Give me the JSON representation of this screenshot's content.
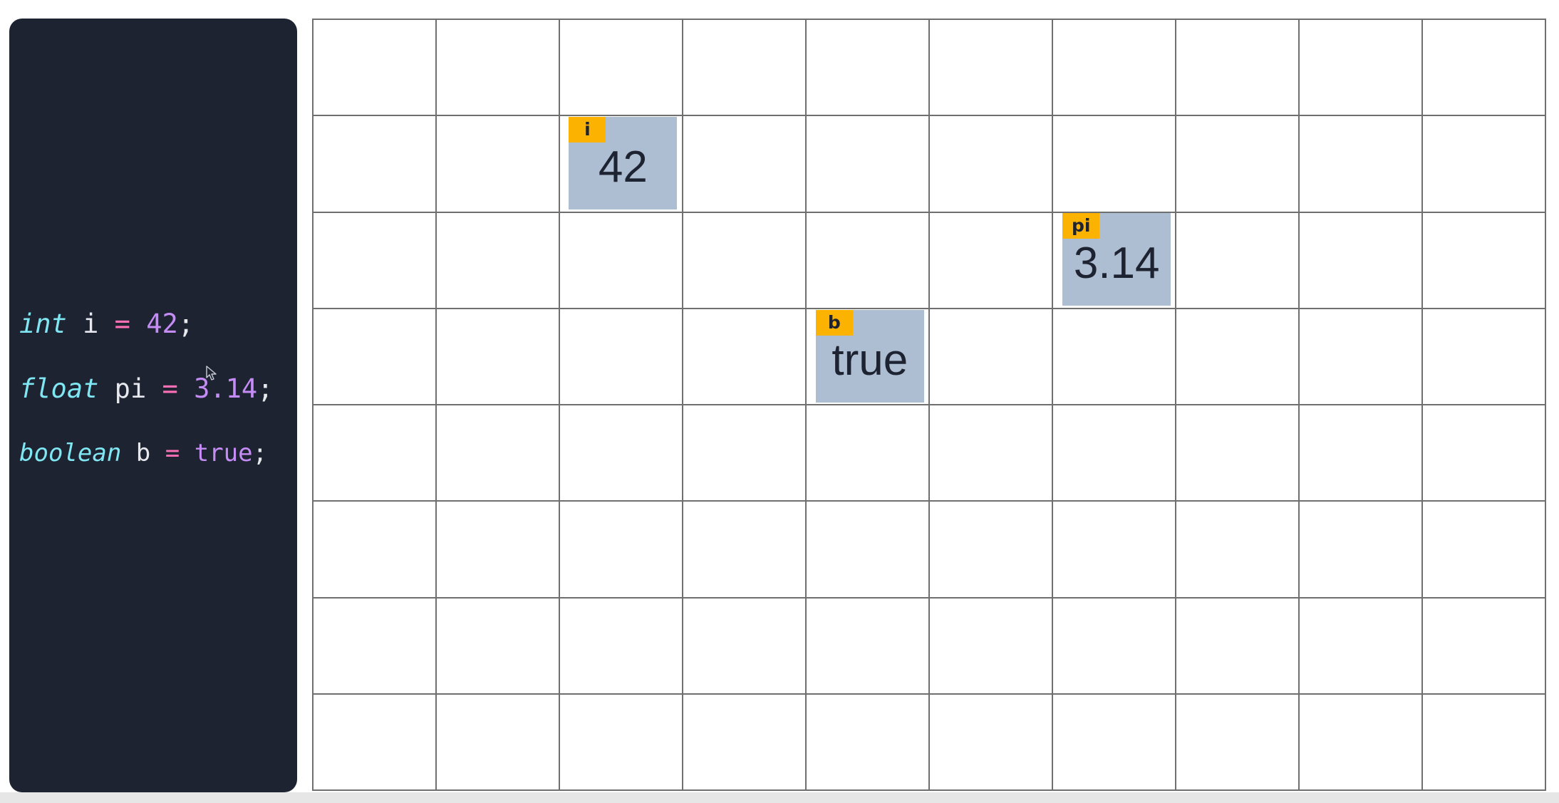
{
  "code": {
    "lines": [
      {
        "type": "int",
        "name": "i",
        "op": "=",
        "value": "42",
        "end": ";"
      },
      {
        "type": "float",
        "name": "pi",
        "op": "=",
        "value": "3.14",
        "end": ";"
      },
      {
        "type": "boolean",
        "name": "b",
        "op": "=",
        "value": "true",
        "end": ";"
      }
    ]
  },
  "memory": {
    "grid_columns": 10,
    "grid_rows": 8,
    "variables": [
      {
        "label": "i",
        "value": "42",
        "column": 3,
        "row": 2
      },
      {
        "label": "pi",
        "value": "3.14",
        "column": 7,
        "row": 3
      },
      {
        "label": "b",
        "value": "true",
        "column": 5,
        "row": 4
      }
    ]
  },
  "colors": {
    "panel_background": "#1e2332",
    "type_keyword": "#7fe6f2",
    "operator": "#ff6fb5",
    "literal": "#c58cf5",
    "variable_box": "#adbdd2",
    "variable_label": "#fbb200",
    "grid_line": "#6f6f6f"
  },
  "icons": {
    "cursor": "mouse-pointer-icon"
  }
}
